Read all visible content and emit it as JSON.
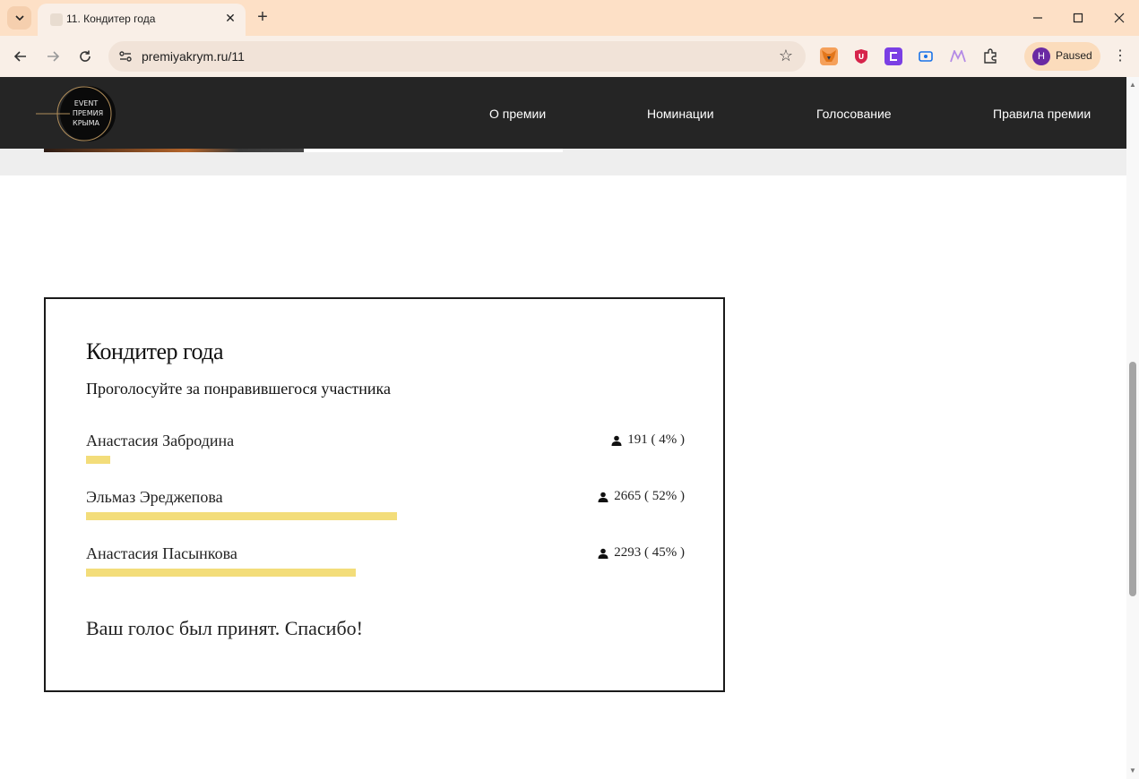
{
  "browser": {
    "tab_title": "11. Кондитер года",
    "url": "premiyakrym.ru/11",
    "profile_initial": "H",
    "profile_status": "Paused"
  },
  "site": {
    "logo": {
      "line1": "EVENT",
      "line2": "ПРЕМИЯ",
      "line3": "КРЫМА"
    },
    "nav": [
      "О премии",
      "Номинации",
      "Голосование",
      "Правила премии"
    ]
  },
  "poll": {
    "title": "Кондитер года",
    "subtitle": "Проголосуйте за понравившегося участника",
    "options": [
      {
        "name": "Анастасия Забродина",
        "votes": "191 ( 4% )",
        "percent": 4
      },
      {
        "name": "Эльмаз Эреджепова",
        "votes": "2665 ( 52% )",
        "percent": 52
      },
      {
        "name": "Анастасия Пасынкова",
        "votes": "2293 ( 45% )",
        "percent": 45
      }
    ],
    "thanks": "Ваш голос был принят. Спасибо!"
  },
  "colors": {
    "bar": "#f3dd7a",
    "header_bg": "#252525",
    "tabstrip_bg": "#fde0c6"
  }
}
